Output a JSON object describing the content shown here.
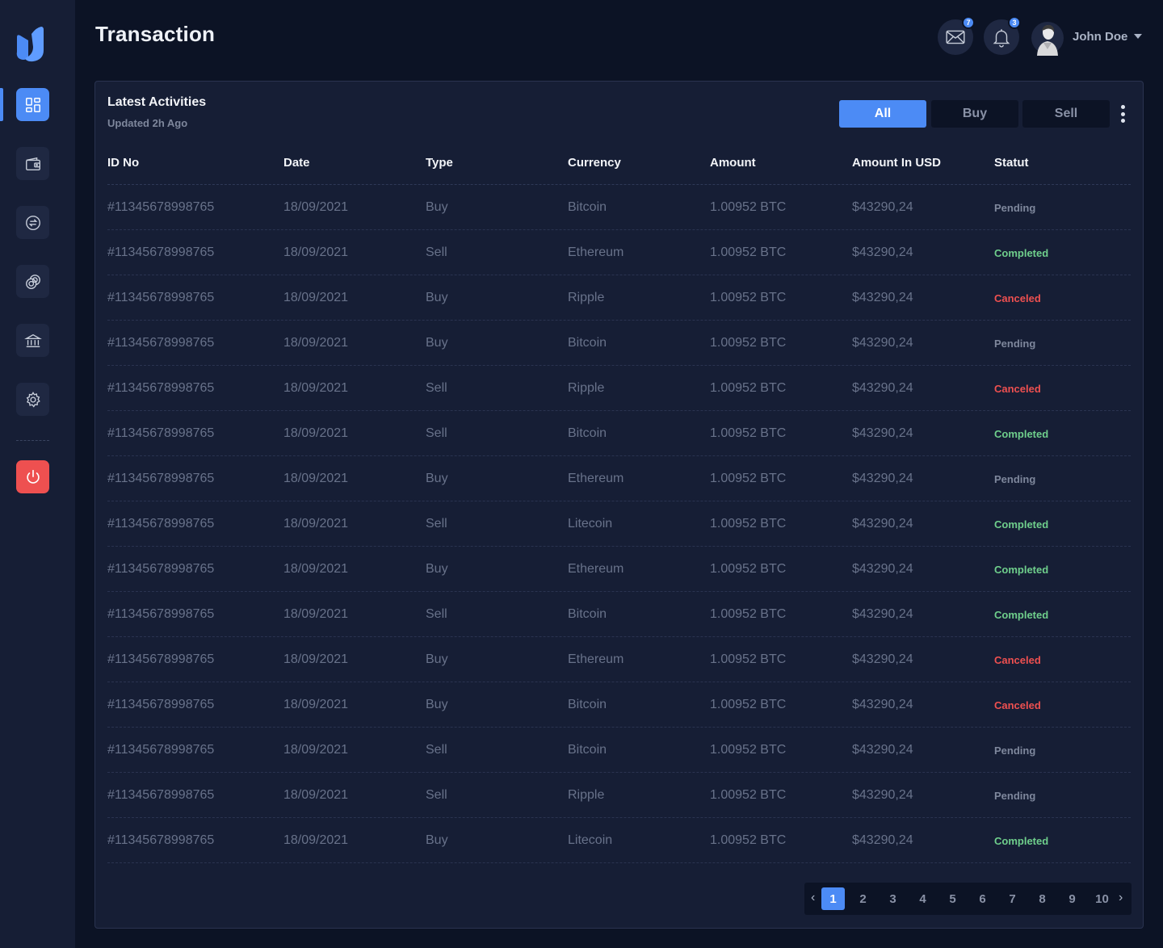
{
  "page": {
    "title": "Transaction"
  },
  "header": {
    "messages_count": "7",
    "notifications_count": "3",
    "user_name": "John Doe"
  },
  "sidebar": {
    "items": [
      {
        "icon": "dashboard-icon",
        "active": true
      },
      {
        "icon": "wallet-icon",
        "active": false
      },
      {
        "icon": "exchange-icon",
        "active": false
      },
      {
        "icon": "coins-icon",
        "active": false
      },
      {
        "icon": "bank-icon",
        "active": false
      },
      {
        "icon": "gear-icon",
        "active": false
      }
    ],
    "logout_icon": "power-icon"
  },
  "card": {
    "title": "Latest Activities",
    "subtitle": "Updated 2h Ago",
    "filters": [
      "All",
      "Buy",
      "Sell"
    ],
    "active_filter": "All"
  },
  "table": {
    "headers": [
      "ID No",
      "Date",
      "Type",
      "Currency",
      "Amount",
      "Amount In USD",
      "Statut"
    ],
    "rows": [
      {
        "id": "#11345678998765",
        "date": "18/09/2021",
        "type": "Buy",
        "currency": "Bitcoin",
        "amount": "1.00952 BTC",
        "usd": "$43290,24",
        "status": "Pending"
      },
      {
        "id": "#11345678998765",
        "date": "18/09/2021",
        "type": "Sell",
        "currency": "Ethereum",
        "amount": "1.00952 BTC",
        "usd": "$43290,24",
        "status": "Completed"
      },
      {
        "id": "#11345678998765",
        "date": "18/09/2021",
        "type": "Buy",
        "currency": "Ripple",
        "amount": "1.00952 BTC",
        "usd": "$43290,24",
        "status": "Canceled"
      },
      {
        "id": "#11345678998765",
        "date": "18/09/2021",
        "type": "Buy",
        "currency": "Bitcoin",
        "amount": "1.00952 BTC",
        "usd": "$43290,24",
        "status": "Pending"
      },
      {
        "id": "#11345678998765",
        "date": "18/09/2021",
        "type": "Sell",
        "currency": "Ripple",
        "amount": "1.00952 BTC",
        "usd": "$43290,24",
        "status": "Canceled"
      },
      {
        "id": "#11345678998765",
        "date": "18/09/2021",
        "type": "Sell",
        "currency": "Bitcoin",
        "amount": "1.00952 BTC",
        "usd": "$43290,24",
        "status": "Completed"
      },
      {
        "id": "#11345678998765",
        "date": "18/09/2021",
        "type": "Buy",
        "currency": "Ethereum",
        "amount": "1.00952 BTC",
        "usd": "$43290,24",
        "status": "Pending"
      },
      {
        "id": "#11345678998765",
        "date": "18/09/2021",
        "type": "Sell",
        "currency": "Litecoin",
        "amount": "1.00952 BTC",
        "usd": "$43290,24",
        "status": "Completed"
      },
      {
        "id": "#11345678998765",
        "date": "18/09/2021",
        "type": "Buy",
        "currency": "Ethereum",
        "amount": "1.00952 BTC",
        "usd": "$43290,24",
        "status": "Completed"
      },
      {
        "id": "#11345678998765",
        "date": "18/09/2021",
        "type": "Sell",
        "currency": "Bitcoin",
        "amount": "1.00952 BTC",
        "usd": "$43290,24",
        "status": "Completed"
      },
      {
        "id": "#11345678998765",
        "date": "18/09/2021",
        "type": "Buy",
        "currency": "Ethereum",
        "amount": "1.00952 BTC",
        "usd": "$43290,24",
        "status": "Canceled"
      },
      {
        "id": "#11345678998765",
        "date": "18/09/2021",
        "type": "Buy",
        "currency": "Bitcoin",
        "amount": "1.00952 BTC",
        "usd": "$43290,24",
        "status": "Canceled"
      },
      {
        "id": "#11345678998765",
        "date": "18/09/2021",
        "type": "Sell",
        "currency": "Bitcoin",
        "amount": "1.00952 BTC",
        "usd": "$43290,24",
        "status": "Pending"
      },
      {
        "id": "#11345678998765",
        "date": "18/09/2021",
        "type": "Sell",
        "currency": "Ripple",
        "amount": "1.00952 BTC",
        "usd": "$43290,24",
        "status": "Pending"
      },
      {
        "id": "#11345678998765",
        "date": "18/09/2021",
        "type": "Buy",
        "currency": "Litecoin",
        "amount": "1.00952 BTC",
        "usd": "$43290,24",
        "status": "Completed"
      }
    ]
  },
  "pagination": {
    "pages": [
      "1",
      "2",
      "3",
      "4",
      "5",
      "6",
      "7",
      "8",
      "9",
      "10"
    ],
    "current": "1",
    "prev": "‹",
    "next": "›"
  },
  "colors": {
    "accent": "#4c8bf5",
    "danger": "#ee5050",
    "success": "#6fcf8c",
    "background": "#0c1325",
    "panel": "#161e35"
  }
}
